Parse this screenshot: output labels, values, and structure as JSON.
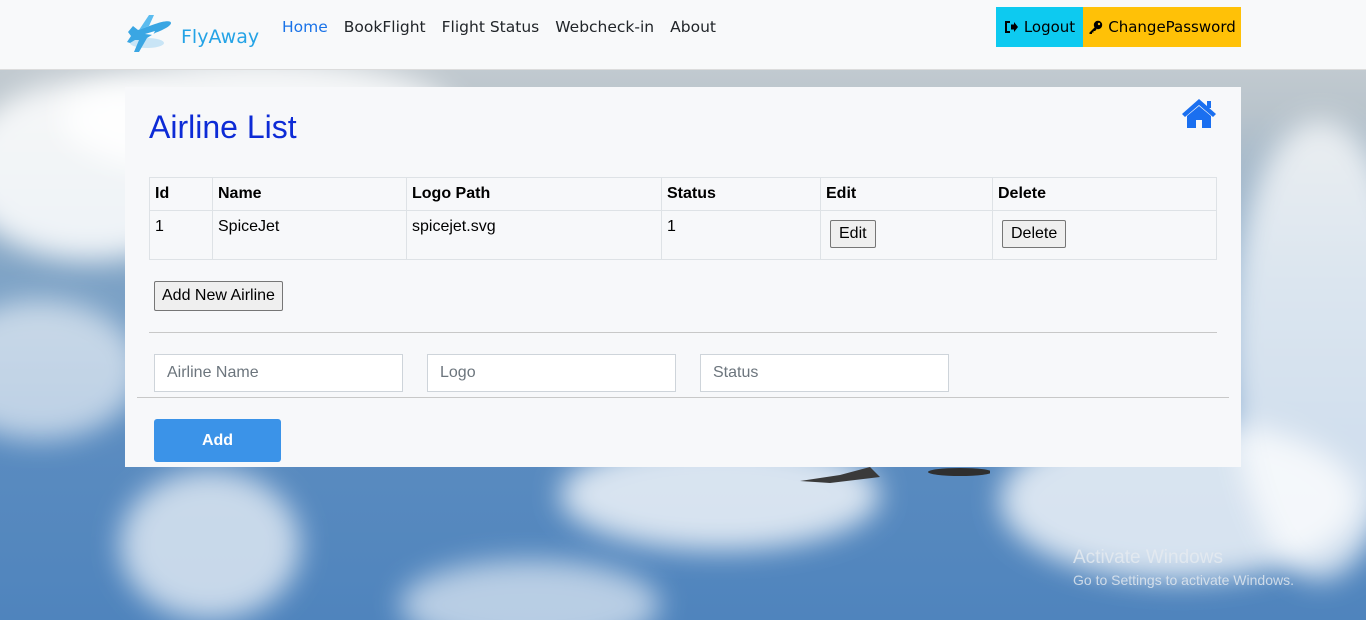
{
  "brand": {
    "name": "FlyAway",
    "logo_icon": "airplane-icon"
  },
  "nav": {
    "links": [
      "Home",
      "BookFlight",
      "Flight Status",
      "Webcheck-in",
      "About"
    ],
    "active": "Home"
  },
  "header_buttons": {
    "logout": {
      "label": "Logout",
      "icon": "sign-out-icon",
      "color": "#0dcaf0"
    },
    "change_password": {
      "label": "ChangePassword",
      "icon": "key-icon",
      "color": "#ffc107"
    }
  },
  "page": {
    "title": "Airline List",
    "home_icon": "home-icon"
  },
  "table": {
    "columns": [
      "Id",
      "Name",
      "Logo Path",
      "Status",
      "Edit",
      "Delete"
    ],
    "rows": [
      {
        "id": "1",
        "name": "SpiceJet",
        "logo_path": "spicejet.svg",
        "status": "1",
        "edit_label": "Edit",
        "delete_label": "Delete"
      }
    ]
  },
  "add_new_label": "Add New Airline",
  "form": {
    "airline_name_placeholder": "Airline Name",
    "logo_placeholder": "Logo",
    "status_placeholder": "Status",
    "submit_label": "Add"
  },
  "watermark": {
    "line1": "Activate Windows",
    "line2": "Go to Settings to activate Windows."
  },
  "colors": {
    "title": "#0d2bd6",
    "add_button": "#3b93e8",
    "brand": "#24a3e6",
    "active_link": "#1a73e8"
  }
}
